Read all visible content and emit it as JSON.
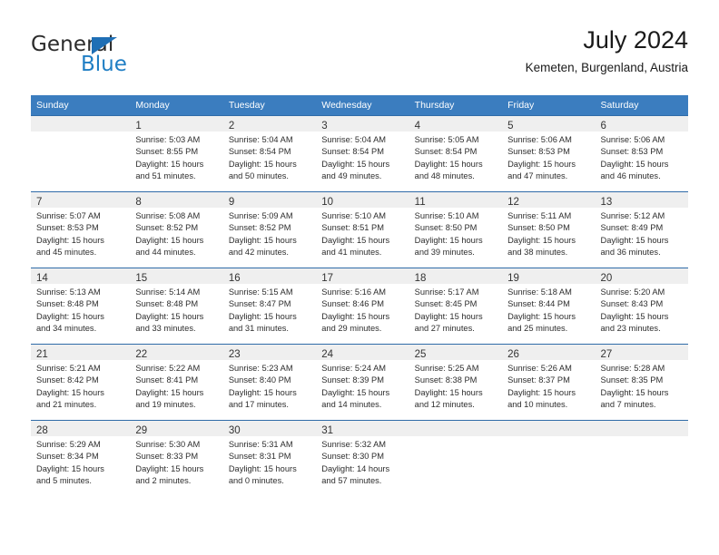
{
  "brand": {
    "name_top": "General",
    "name_bottom": "Blue",
    "triangle_color": "#1f6fb5",
    "blue_color": "#1f7ec4"
  },
  "header": {
    "title": "July 2024",
    "subtitle": "Kemeten, Burgenland, Austria"
  },
  "theme": {
    "header_row_bg": "#3b7dbf",
    "row_separator": "#2f6ba8",
    "daynum_band_bg": "#efefef",
    "text": "#2d2d2d"
  },
  "weekdays": [
    "Sunday",
    "Monday",
    "Tuesday",
    "Wednesday",
    "Thursday",
    "Friday",
    "Saturday"
  ],
  "weeks": [
    [
      {
        "day": "",
        "lines": []
      },
      {
        "day": "1",
        "lines": [
          "Sunrise: 5:03 AM",
          "Sunset: 8:55 PM",
          "Daylight: 15 hours",
          "and 51 minutes."
        ]
      },
      {
        "day": "2",
        "lines": [
          "Sunrise: 5:04 AM",
          "Sunset: 8:54 PM",
          "Daylight: 15 hours",
          "and 50 minutes."
        ]
      },
      {
        "day": "3",
        "lines": [
          "Sunrise: 5:04 AM",
          "Sunset: 8:54 PM",
          "Daylight: 15 hours",
          "and 49 minutes."
        ]
      },
      {
        "day": "4",
        "lines": [
          "Sunrise: 5:05 AM",
          "Sunset: 8:54 PM",
          "Daylight: 15 hours",
          "and 48 minutes."
        ]
      },
      {
        "day": "5",
        "lines": [
          "Sunrise: 5:06 AM",
          "Sunset: 8:53 PM",
          "Daylight: 15 hours",
          "and 47 minutes."
        ]
      },
      {
        "day": "6",
        "lines": [
          "Sunrise: 5:06 AM",
          "Sunset: 8:53 PM",
          "Daylight: 15 hours",
          "and 46 minutes."
        ]
      }
    ],
    [
      {
        "day": "7",
        "lines": [
          "Sunrise: 5:07 AM",
          "Sunset: 8:53 PM",
          "Daylight: 15 hours",
          "and 45 minutes."
        ]
      },
      {
        "day": "8",
        "lines": [
          "Sunrise: 5:08 AM",
          "Sunset: 8:52 PM",
          "Daylight: 15 hours",
          "and 44 minutes."
        ]
      },
      {
        "day": "9",
        "lines": [
          "Sunrise: 5:09 AM",
          "Sunset: 8:52 PM",
          "Daylight: 15 hours",
          "and 42 minutes."
        ]
      },
      {
        "day": "10",
        "lines": [
          "Sunrise: 5:10 AM",
          "Sunset: 8:51 PM",
          "Daylight: 15 hours",
          "and 41 minutes."
        ]
      },
      {
        "day": "11",
        "lines": [
          "Sunrise: 5:10 AM",
          "Sunset: 8:50 PM",
          "Daylight: 15 hours",
          "and 39 minutes."
        ]
      },
      {
        "day": "12",
        "lines": [
          "Sunrise: 5:11 AM",
          "Sunset: 8:50 PM",
          "Daylight: 15 hours",
          "and 38 minutes."
        ]
      },
      {
        "day": "13",
        "lines": [
          "Sunrise: 5:12 AM",
          "Sunset: 8:49 PM",
          "Daylight: 15 hours",
          "and 36 minutes."
        ]
      }
    ],
    [
      {
        "day": "14",
        "lines": [
          "Sunrise: 5:13 AM",
          "Sunset: 8:48 PM",
          "Daylight: 15 hours",
          "and 34 minutes."
        ]
      },
      {
        "day": "15",
        "lines": [
          "Sunrise: 5:14 AM",
          "Sunset: 8:48 PM",
          "Daylight: 15 hours",
          "and 33 minutes."
        ]
      },
      {
        "day": "16",
        "lines": [
          "Sunrise: 5:15 AM",
          "Sunset: 8:47 PM",
          "Daylight: 15 hours",
          "and 31 minutes."
        ]
      },
      {
        "day": "17",
        "lines": [
          "Sunrise: 5:16 AM",
          "Sunset: 8:46 PM",
          "Daylight: 15 hours",
          "and 29 minutes."
        ]
      },
      {
        "day": "18",
        "lines": [
          "Sunrise: 5:17 AM",
          "Sunset: 8:45 PM",
          "Daylight: 15 hours",
          "and 27 minutes."
        ]
      },
      {
        "day": "19",
        "lines": [
          "Sunrise: 5:18 AM",
          "Sunset: 8:44 PM",
          "Daylight: 15 hours",
          "and 25 minutes."
        ]
      },
      {
        "day": "20",
        "lines": [
          "Sunrise: 5:20 AM",
          "Sunset: 8:43 PM",
          "Daylight: 15 hours",
          "and 23 minutes."
        ]
      }
    ],
    [
      {
        "day": "21",
        "lines": [
          "Sunrise: 5:21 AM",
          "Sunset: 8:42 PM",
          "Daylight: 15 hours",
          "and 21 minutes."
        ]
      },
      {
        "day": "22",
        "lines": [
          "Sunrise: 5:22 AM",
          "Sunset: 8:41 PM",
          "Daylight: 15 hours",
          "and 19 minutes."
        ]
      },
      {
        "day": "23",
        "lines": [
          "Sunrise: 5:23 AM",
          "Sunset: 8:40 PM",
          "Daylight: 15 hours",
          "and 17 minutes."
        ]
      },
      {
        "day": "24",
        "lines": [
          "Sunrise: 5:24 AM",
          "Sunset: 8:39 PM",
          "Daylight: 15 hours",
          "and 14 minutes."
        ]
      },
      {
        "day": "25",
        "lines": [
          "Sunrise: 5:25 AM",
          "Sunset: 8:38 PM",
          "Daylight: 15 hours",
          "and 12 minutes."
        ]
      },
      {
        "day": "26",
        "lines": [
          "Sunrise: 5:26 AM",
          "Sunset: 8:37 PM",
          "Daylight: 15 hours",
          "and 10 minutes."
        ]
      },
      {
        "day": "27",
        "lines": [
          "Sunrise: 5:28 AM",
          "Sunset: 8:35 PM",
          "Daylight: 15 hours",
          "and 7 minutes."
        ]
      }
    ],
    [
      {
        "day": "28",
        "lines": [
          "Sunrise: 5:29 AM",
          "Sunset: 8:34 PM",
          "Daylight: 15 hours",
          "and 5 minutes."
        ]
      },
      {
        "day": "29",
        "lines": [
          "Sunrise: 5:30 AM",
          "Sunset: 8:33 PM",
          "Daylight: 15 hours",
          "and 2 minutes."
        ]
      },
      {
        "day": "30",
        "lines": [
          "Sunrise: 5:31 AM",
          "Sunset: 8:31 PM",
          "Daylight: 15 hours",
          "and 0 minutes."
        ]
      },
      {
        "day": "31",
        "lines": [
          "Sunrise: 5:32 AM",
          "Sunset: 8:30 PM",
          "Daylight: 14 hours",
          "and 57 minutes."
        ]
      },
      {
        "day": "",
        "lines": []
      },
      {
        "day": "",
        "lines": []
      },
      {
        "day": "",
        "lines": []
      }
    ]
  ]
}
